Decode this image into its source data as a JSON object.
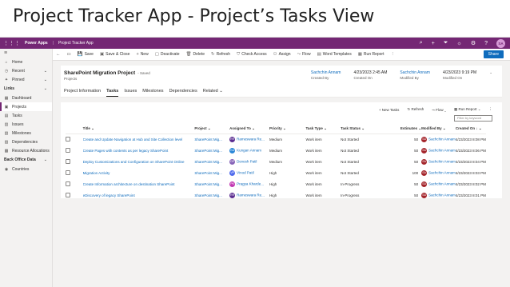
{
  "slide_title": "Project Tracker App -  Project’s Tasks View",
  "topbar": {
    "brand": "Power Apps",
    "app_name": "Project Tracker App",
    "avatar_initials": "SA"
  },
  "sidebar": {
    "menu_icon": "≡",
    "top_items": [
      {
        "label": "Home",
        "icon": "⌂"
      },
      {
        "label": "Recent",
        "icon": "◷",
        "chevron": "⌄"
      },
      {
        "label": "Pinned",
        "icon": "✦",
        "chevron": "⌄"
      }
    ],
    "groups": [
      {
        "label": "Links",
        "chevron": "⌄",
        "items": [
          {
            "label": "Dashboard",
            "icon": "▦"
          },
          {
            "label": "Projects",
            "icon": "▣",
            "active": true
          },
          {
            "label": "Tasks",
            "icon": "▤"
          },
          {
            "label": "Issues",
            "icon": "▥"
          },
          {
            "label": "Milestones",
            "icon": "▧"
          },
          {
            "label": "Dependencies",
            "icon": "▨"
          },
          {
            "label": "Resource Allocations",
            "icon": "▩"
          }
        ]
      },
      {
        "label": "Back Office Data",
        "chevron": "⌄",
        "items": [
          {
            "label": "Countries",
            "icon": "◉"
          }
        ]
      }
    ]
  },
  "cmdbar": {
    "items": [
      {
        "label": "",
        "icon": "←"
      },
      {
        "label": "",
        "icon": "▭"
      },
      {
        "label": "Save",
        "icon": "💾"
      },
      {
        "label": "Save & Close",
        "icon": "▣"
      },
      {
        "label": "New",
        "icon": "+"
      },
      {
        "label": "Deactivate",
        "icon": "▢"
      },
      {
        "label": "Delete",
        "icon": "🗑"
      },
      {
        "label": "Refresh",
        "icon": "↻"
      },
      {
        "label": "Check Access",
        "icon": "⛉"
      },
      {
        "label": "Assign",
        "icon": "⚇"
      },
      {
        "label": "Flow",
        "icon": "⤳"
      },
      {
        "label": "Word Templates",
        "icon": "▤"
      },
      {
        "label": "Run Report",
        "icon": "▦"
      },
      {
        "label": "",
        "icon": "⋮"
      }
    ],
    "share": "Share"
  },
  "record": {
    "title": "SharePoint Migration Project",
    "saved": "- Saved",
    "entity": "Projects",
    "header_fields": [
      {
        "value": "Sachchin Annam",
        "label": "Created By",
        "link": true
      },
      {
        "value": "4/23/2023 2:45 AM",
        "label": "Created On",
        "link": false
      },
      {
        "value": "Sachchin Annam",
        "label": "Modified By",
        "link": true
      },
      {
        "value": "4/23/2023 9:19 PM",
        "label": "Modified On",
        "link": false
      }
    ],
    "tabs": [
      "Project Information",
      "Tasks",
      "Issues",
      "Milestones",
      "Dependencies",
      "Related ⌄"
    ],
    "active_tab": "Tasks"
  },
  "grid": {
    "commands": [
      "+ New Tasks",
      "↻ Refresh",
      "⤳ Flow ⌄",
      "▦ Run Report ⌄",
      "⋮"
    ],
    "filter_placeholder": "Filter by keyword",
    "columns": [
      "Title ⌄",
      "Project ⌄",
      "Assigned To ⌄",
      "Priority ⌄",
      "Task Type ⌄",
      "Task Status ⌄",
      "Estimates ⌄",
      "Modified By ⌄",
      "Created On ↓ ⌄"
    ],
    "rows": [
      {
        "title": "Create and Update Navigation at Hub and Site Collection level",
        "project": "SharePoint Mig...",
        "assignee": "Rameswara Re...",
        "assignee_initials": "RR",
        "badge_color": "#5c2e91",
        "priority": "Medium",
        "type": "Work item",
        "status": "Not Started",
        "estimate": "50",
        "modified_by": "Sachchin Annam",
        "created_on": "4/23/2023 8:08 PM"
      },
      {
        "title": "Create Pages with contents as per legacy SharePoint",
        "project": "SharePoint Mig...",
        "assignee": "Kungan Annam",
        "assignee_initials": "KA",
        "badge_color": "#2b88d8",
        "priority": "Medium",
        "type": "Work item",
        "status": "Not Started",
        "estimate": "50",
        "modified_by": "Sachchin Annam",
        "created_on": "4/23/2023 8:06 PM"
      },
      {
        "title": "Deploy Customizations and Configuration on SharePoint Online",
        "project": "SharePoint Mig...",
        "assignee": "Devesh Patil",
        "assignee_initials": "DP",
        "badge_color": "#8764b8",
        "priority": "Medium",
        "type": "Work item",
        "status": "Not Started",
        "estimate": "50",
        "modified_by": "Sachchin Annam",
        "created_on": "4/23/2023 8:04 PM"
      },
      {
        "title": "Migration Activity",
        "project": "SharePoint Mig...",
        "assignee": "Vinod Patil",
        "assignee_initials": "VP",
        "badge_color": "#4f6bed",
        "priority": "High",
        "type": "Work item",
        "status": "Not Started",
        "estimate": "100",
        "modified_by": "Sachchin Annam",
        "created_on": "4/23/2023 8:03 PM"
      },
      {
        "title": "Create Information architecture on destination SharePoint",
        "project": "SharePoint Mig...",
        "assignee": "Pragya Kharde...",
        "assignee_initials": "PK",
        "badge_color": "#c239b3",
        "priority": "High",
        "type": "Work item",
        "status": "In-Progress",
        "estimate": "50",
        "modified_by": "Sachchin Annam",
        "created_on": "4/23/2023 8:02 PM"
      },
      {
        "title": "eDiscovery of legacy SharePoint",
        "project": "SharePoint Mig...",
        "assignee": "Rameswara Re...",
        "assignee_initials": "RR",
        "badge_color": "#5c2e91",
        "priority": "High",
        "type": "Work item",
        "status": "In-Progress",
        "estimate": "50",
        "modified_by": "Sachchin Annam",
        "created_on": "4/23/2023 8:01 PM"
      }
    ],
    "modified_initials": "SA",
    "modified_badge_color": "#a4262c"
  },
  "colors": {
    "brand": "#742774",
    "link": "#0f6cbd"
  }
}
